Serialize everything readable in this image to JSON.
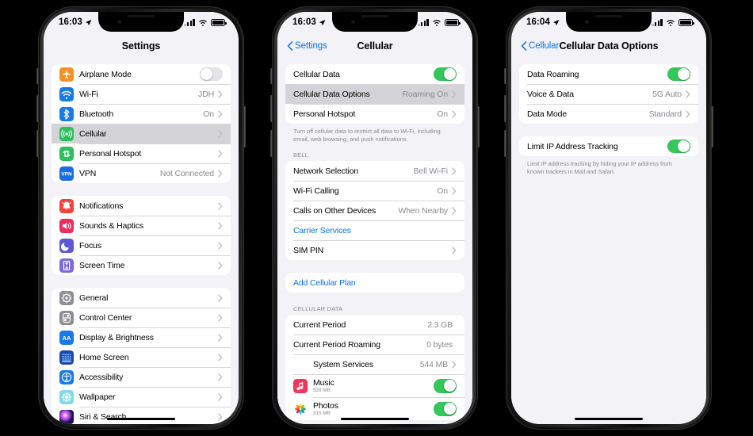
{
  "screens": [
    {
      "id": "settings",
      "status": {
        "time": "16:03",
        "location_icon": "location-arrow-icon",
        "signal_icon": "cellular-bars-icon",
        "wifi_icon": "wifi-icon",
        "battery_icon": "battery-icon"
      },
      "nav": {
        "title": "Settings",
        "back_label": null
      },
      "groups": [
        {
          "type": "list",
          "rows": [
            {
              "icon": "airplane-icon",
              "label": "Airplane Mode",
              "control": "toggle",
              "on": false
            },
            {
              "icon": "wifi-icon",
              "label": "Wi-Fi",
              "value": "JDH",
              "chevron": true
            },
            {
              "icon": "bluetooth-icon",
              "label": "Bluetooth",
              "value": "On",
              "chevron": true
            },
            {
              "icon": "cellular-icon",
              "label": "Cellular",
              "value": "",
              "chevron": true,
              "highlight": true
            },
            {
              "icon": "hotspot-icon",
              "label": "Personal Hotspot",
              "value": "",
              "chevron": true
            },
            {
              "icon": "vpn-icon",
              "label": "VPN",
              "value": "Not Connected",
              "chevron": true
            }
          ]
        },
        {
          "type": "list",
          "rows": [
            {
              "icon": "notifications-icon",
              "label": "Notifications",
              "chevron": true
            },
            {
              "icon": "sounds-icon",
              "label": "Sounds & Haptics",
              "chevron": true
            },
            {
              "icon": "focus-icon",
              "label": "Focus",
              "chevron": true
            },
            {
              "icon": "screentime-icon",
              "label": "Screen Time",
              "chevron": true
            }
          ]
        },
        {
          "type": "list",
          "rows": [
            {
              "icon": "general-icon",
              "label": "General",
              "chevron": true
            },
            {
              "icon": "controlcenter-icon",
              "label": "Control Center",
              "chevron": true
            },
            {
              "icon": "display-icon",
              "label": "Display & Brightness",
              "chevron": true
            },
            {
              "icon": "homescreen-icon",
              "label": "Home Screen",
              "chevron": true
            },
            {
              "icon": "accessibility-icon",
              "label": "Accessibility",
              "chevron": true
            },
            {
              "icon": "wallpaper-icon",
              "label": "Wallpaper",
              "chevron": true
            },
            {
              "icon": "siri-icon",
              "label": "Siri & Search",
              "chevron": true
            }
          ]
        }
      ]
    },
    {
      "id": "cellular",
      "status": {
        "time": "16:03"
      },
      "nav": {
        "title": "Cellular",
        "back_label": "Settings"
      },
      "groups": [
        {
          "type": "list",
          "rows": [
            {
              "label": "Cellular Data",
              "control": "toggle",
              "on": true
            },
            {
              "label": "Cellular Data Options",
              "value": "Roaming On",
              "chevron": true,
              "highlight": true
            },
            {
              "label": "Personal Hotspot",
              "value": "On",
              "chevron": true
            }
          ]
        },
        {
          "type": "footer",
          "text": "Turn off cellular data to restrict all data to Wi-Fi, including email, web browsing, and push notifications."
        },
        {
          "type": "header",
          "text": "BELL"
        },
        {
          "type": "list",
          "rows": [
            {
              "label": "Network Selection",
              "value": "Bell Wi-Fi",
              "chevron": true
            },
            {
              "label": "Wi-Fi Calling",
              "value": "On",
              "chevron": true
            },
            {
              "label": "Calls on Other Devices",
              "value": "When Nearby",
              "chevron": true
            },
            {
              "label": "Carrier Services",
              "blue": true
            },
            {
              "label": "SIM PIN",
              "chevron": true
            }
          ]
        },
        {
          "type": "list",
          "rows": [
            {
              "label": "Add Cellular Plan",
              "blue": true
            }
          ]
        },
        {
          "type": "header",
          "text": "CELLULAR DATA"
        },
        {
          "type": "list",
          "rows": [
            {
              "label": "Current Period",
              "value": "2.3 GB"
            },
            {
              "label": "Current Period Roaming",
              "value": "0 bytes"
            },
            {
              "label": "System Services",
              "value": "544 MB",
              "chevron": true,
              "indent": true
            },
            {
              "icon": "music-icon",
              "label": "Music",
              "sub": "529 MB",
              "control": "toggle",
              "on": true
            },
            {
              "icon": "photos-icon",
              "label": "Photos",
              "sub": "315 MB",
              "control": "toggle",
              "on": true
            }
          ]
        }
      ]
    },
    {
      "id": "cellular-data-options",
      "status": {
        "time": "16:04"
      },
      "nav": {
        "title": "Cellular Data Options",
        "back_label": "Cellular"
      },
      "groups": [
        {
          "type": "list",
          "rows": [
            {
              "label": "Data Roaming",
              "control": "toggle",
              "on": true
            },
            {
              "label": "Voice & Data",
              "value": "5G Auto",
              "chevron": true
            },
            {
              "label": "Data Mode",
              "value": "Standard",
              "chevron": true
            }
          ]
        },
        {
          "type": "list",
          "rows": [
            {
              "label": "Limit IP Address Tracking",
              "control": "toggle",
              "on": true
            }
          ]
        },
        {
          "type": "footer",
          "text": "Limit IP address tracking by hiding your IP address from known trackers in Mail and Safari."
        }
      ]
    }
  ],
  "colors": {
    "accent_blue": "#0a74e8",
    "toggle_on": "#34c759",
    "background": "#f2f2f7",
    "row_bg": "#ffffff",
    "highlight": "#d3d3d8",
    "secondary_text": "#8b8b90"
  }
}
